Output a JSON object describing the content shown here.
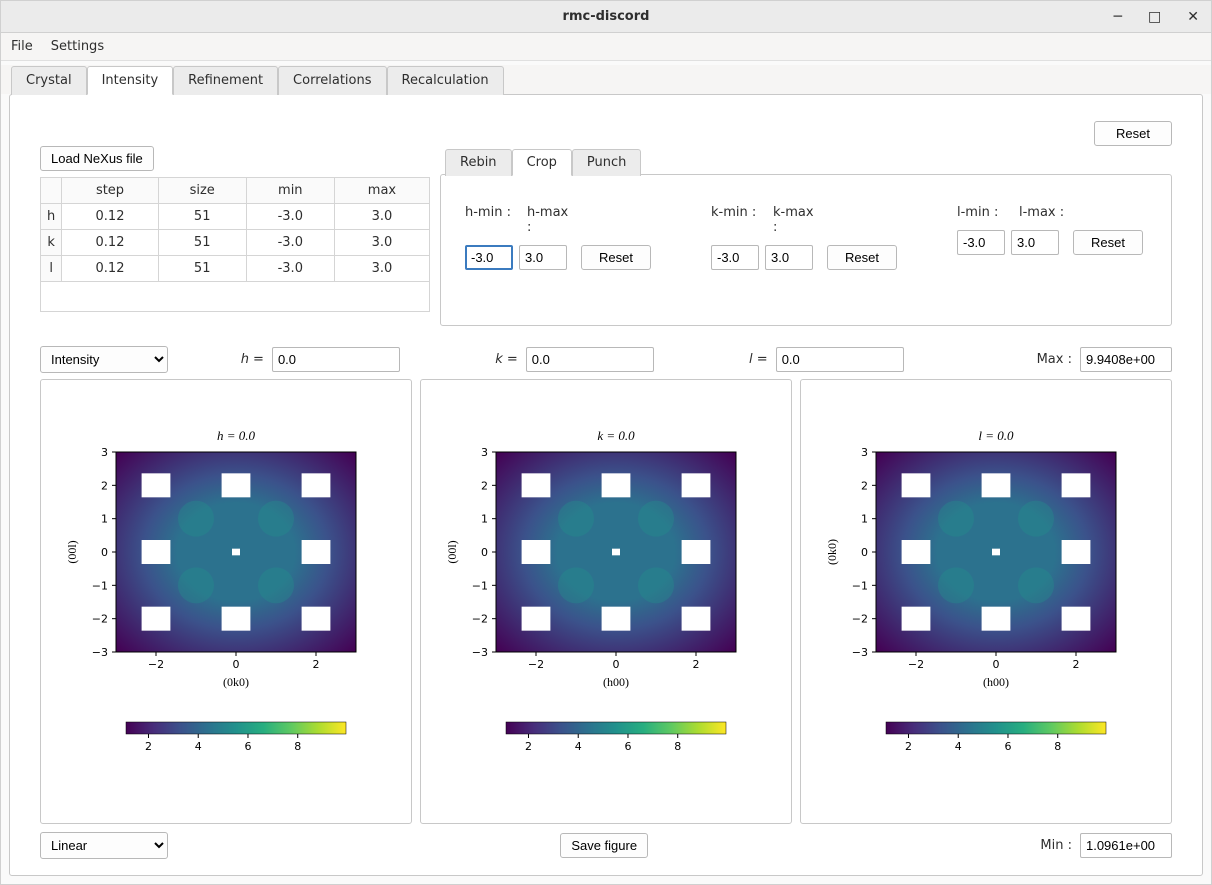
{
  "window": {
    "title": "rmc-discord"
  },
  "menu": {
    "file": "File",
    "settings": "Settings"
  },
  "tabs": {
    "crystal": "Crystal",
    "intensity": "Intensity",
    "refinement": "Refinement",
    "correlations": "Correlations",
    "recalculation": "Recalculation"
  },
  "buttons": {
    "load_nexus": "Load NeXus file",
    "reset": "Reset",
    "save_figure": "Save figure"
  },
  "grid": {
    "headers": {
      "step": "step",
      "size": "size",
      "min": "min",
      "max": "max"
    },
    "rows": [
      {
        "label": "h",
        "step": "0.12",
        "size": "51",
        "min": "-3.0",
        "max": "3.0"
      },
      {
        "label": "k",
        "step": "0.12",
        "size": "51",
        "min": "-3.0",
        "max": "3.0"
      },
      {
        "label": "l",
        "step": "0.12",
        "size": "51",
        "min": "-3.0",
        "max": "3.0"
      }
    ]
  },
  "proc_tabs": {
    "rebin": "Rebin",
    "crop": "Crop",
    "punch": "Punch"
  },
  "crop": {
    "h": {
      "min_label": "h-min :",
      "max_label": "h-max :",
      "min": "-3.0",
      "max": "3.0"
    },
    "k": {
      "min_label": "k-min :",
      "max_label": "k-max :",
      "min": "-3.0",
      "max": "3.0"
    },
    "l": {
      "min_label": "l-min :",
      "max_label": "l-max :",
      "min": "-3.0",
      "max": "3.0"
    }
  },
  "slice": {
    "mode": "Intensity",
    "h_label": "h = ",
    "h_value": "0.0",
    "k_label": "k = ",
    "k_value": "0.0",
    "l_label": "l = ",
    "l_value": "0.0",
    "max_label": "Max :",
    "max_value": "9.9408e+00"
  },
  "plots": {
    "h": {
      "title": "h = 0.0",
      "xlabel": "(0k0)",
      "ylabel": "(00l)"
    },
    "k": {
      "title": "k = 0.0",
      "xlabel": "(h00)",
      "ylabel": "(00l)"
    },
    "l": {
      "title": "l = 0.0",
      "xlabel": "(h00)",
      "ylabel": "(0k0)"
    }
  },
  "bottom": {
    "scale": "Linear",
    "min_label": "Min :",
    "min_value": "1.0961e+00"
  },
  "chart_data": [
    {
      "type": "heatmap",
      "title": "h = 0.0",
      "xlabel": "(0k0)",
      "ylabel": "(00l)",
      "xlim": [
        -3,
        3
      ],
      "ylim": [
        -3,
        3
      ],
      "xticks": [
        -2,
        0,
        2
      ],
      "yticks": [
        -3,
        -2,
        -1,
        0,
        1,
        2,
        3
      ],
      "colorbar_ticks": [
        2,
        4,
        6,
        8
      ],
      "colorbar_range": [
        1.0961,
        9.9408
      ],
      "colormap": "viridis",
      "punched_squares": [
        {
          "center": [
            -2,
            -2
          ],
          "half": 0.36
        },
        {
          "center": [
            0,
            -2
          ],
          "half": 0.36
        },
        {
          "center": [
            2,
            -2
          ],
          "half": 0.36
        },
        {
          "center": [
            -2,
            0
          ],
          "half": 0.36
        },
        {
          "center": [
            2,
            0
          ],
          "half": 0.36
        },
        {
          "center": [
            -2,
            2
          ],
          "half": 0.36
        },
        {
          "center": [
            0,
            2
          ],
          "half": 0.36
        },
        {
          "center": [
            2,
            2
          ],
          "half": 0.36
        },
        {
          "center": [
            0,
            0
          ],
          "half": 0.1
        }
      ]
    },
    {
      "type": "heatmap",
      "title": "k = 0.0",
      "xlabel": "(h00)",
      "ylabel": "(00l)",
      "xlim": [
        -3,
        3
      ],
      "ylim": [
        -3,
        3
      ],
      "xticks": [
        -2,
        0,
        2
      ],
      "yticks": [
        -3,
        -2,
        -1,
        0,
        1,
        2,
        3
      ],
      "colorbar_ticks": [
        2,
        4,
        6,
        8
      ],
      "colorbar_range": [
        1.0961,
        9.9408
      ],
      "colormap": "viridis",
      "punched_squares": [
        {
          "center": [
            -2,
            -2
          ],
          "half": 0.36
        },
        {
          "center": [
            0,
            -2
          ],
          "half": 0.36
        },
        {
          "center": [
            2,
            -2
          ],
          "half": 0.36
        },
        {
          "center": [
            -2,
            0
          ],
          "half": 0.36
        },
        {
          "center": [
            2,
            0
          ],
          "half": 0.36
        },
        {
          "center": [
            -2,
            2
          ],
          "half": 0.36
        },
        {
          "center": [
            0,
            2
          ],
          "half": 0.36
        },
        {
          "center": [
            2,
            2
          ],
          "half": 0.36
        },
        {
          "center": [
            0,
            0
          ],
          "half": 0.1
        }
      ]
    },
    {
      "type": "heatmap",
      "title": "l = 0.0",
      "xlabel": "(h00)",
      "ylabel": "(0k0)",
      "xlim": [
        -3,
        3
      ],
      "ylim": [
        -3,
        3
      ],
      "xticks": [
        -2,
        0,
        2
      ],
      "yticks": [
        -3,
        -2,
        -1,
        0,
        1,
        2,
        3
      ],
      "colorbar_ticks": [
        2,
        4,
        6,
        8
      ],
      "colorbar_range": [
        1.0961,
        9.9408
      ],
      "colormap": "viridis",
      "punched_squares": [
        {
          "center": [
            -2,
            -2
          ],
          "half": 0.36
        },
        {
          "center": [
            0,
            -2
          ],
          "half": 0.36
        },
        {
          "center": [
            2,
            -2
          ],
          "half": 0.36
        },
        {
          "center": [
            -2,
            0
          ],
          "half": 0.36
        },
        {
          "center": [
            2,
            0
          ],
          "half": 0.36
        },
        {
          "center": [
            -2,
            2
          ],
          "half": 0.36
        },
        {
          "center": [
            0,
            2
          ],
          "half": 0.36
        },
        {
          "center": [
            2,
            2
          ],
          "half": 0.36
        },
        {
          "center": [
            0,
            0
          ],
          "half": 0.1
        }
      ]
    }
  ]
}
